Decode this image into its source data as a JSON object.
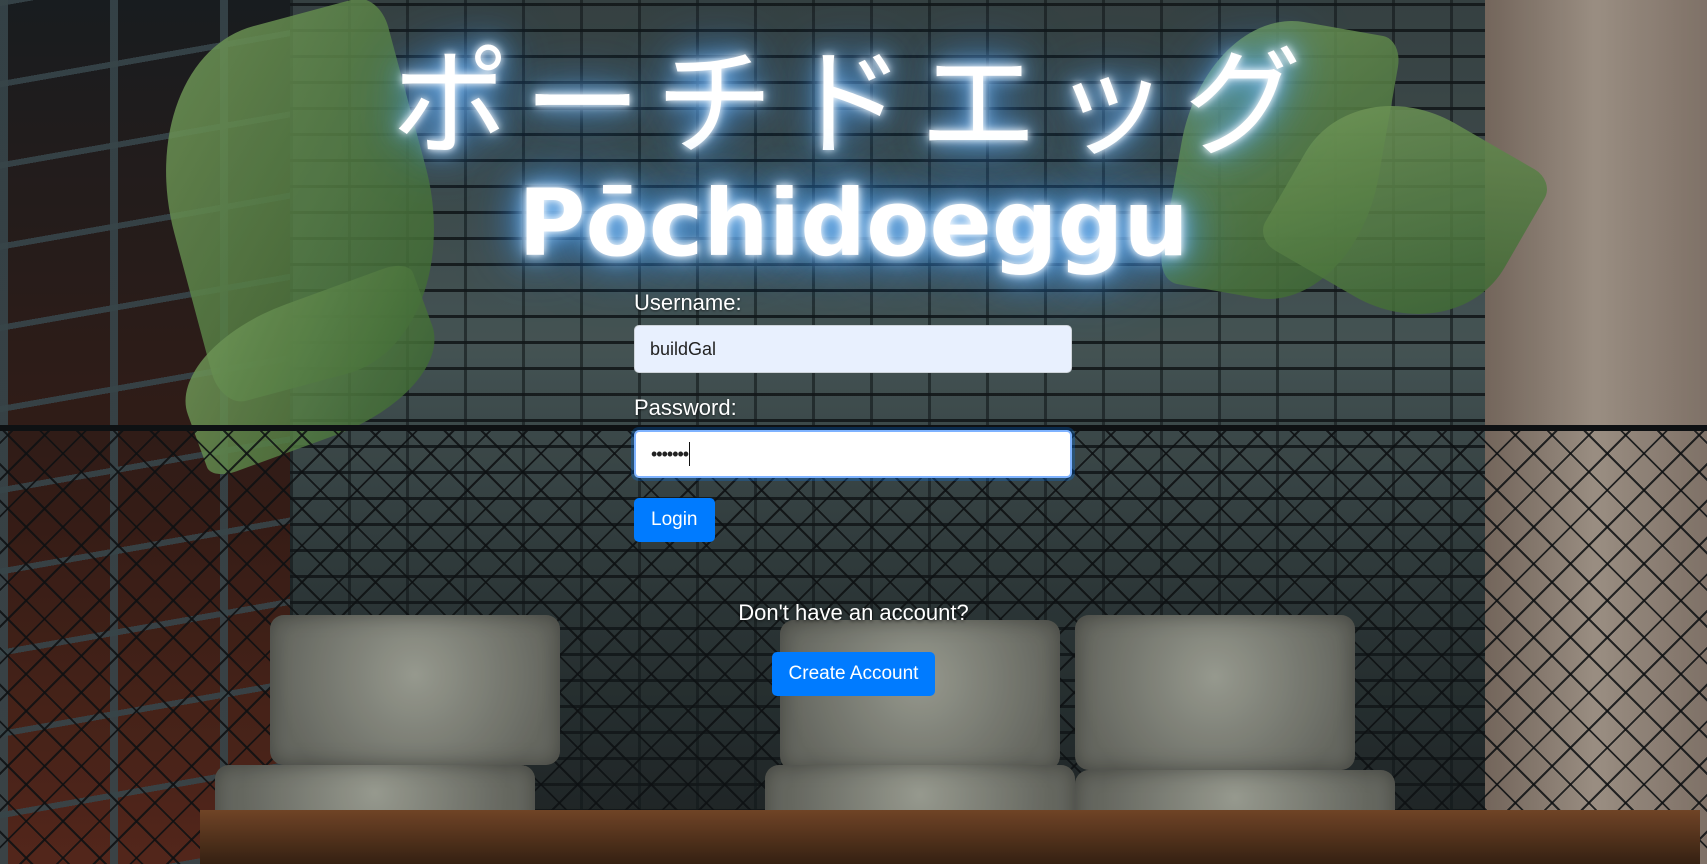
{
  "neon": {
    "japanese": "ポーチドエッグ",
    "romaji": "Pōchidoeggu"
  },
  "login_form": {
    "username_label": "Username:",
    "username_value": "buildGal",
    "password_label": "Password:",
    "password_value": "•••••••",
    "login_button": "Login"
  },
  "signup": {
    "prompt": "Don't have an account?",
    "create_button": "Create Account"
  },
  "colors": {
    "accent": "#007bff",
    "neon_glow": "#4aa8ff"
  }
}
